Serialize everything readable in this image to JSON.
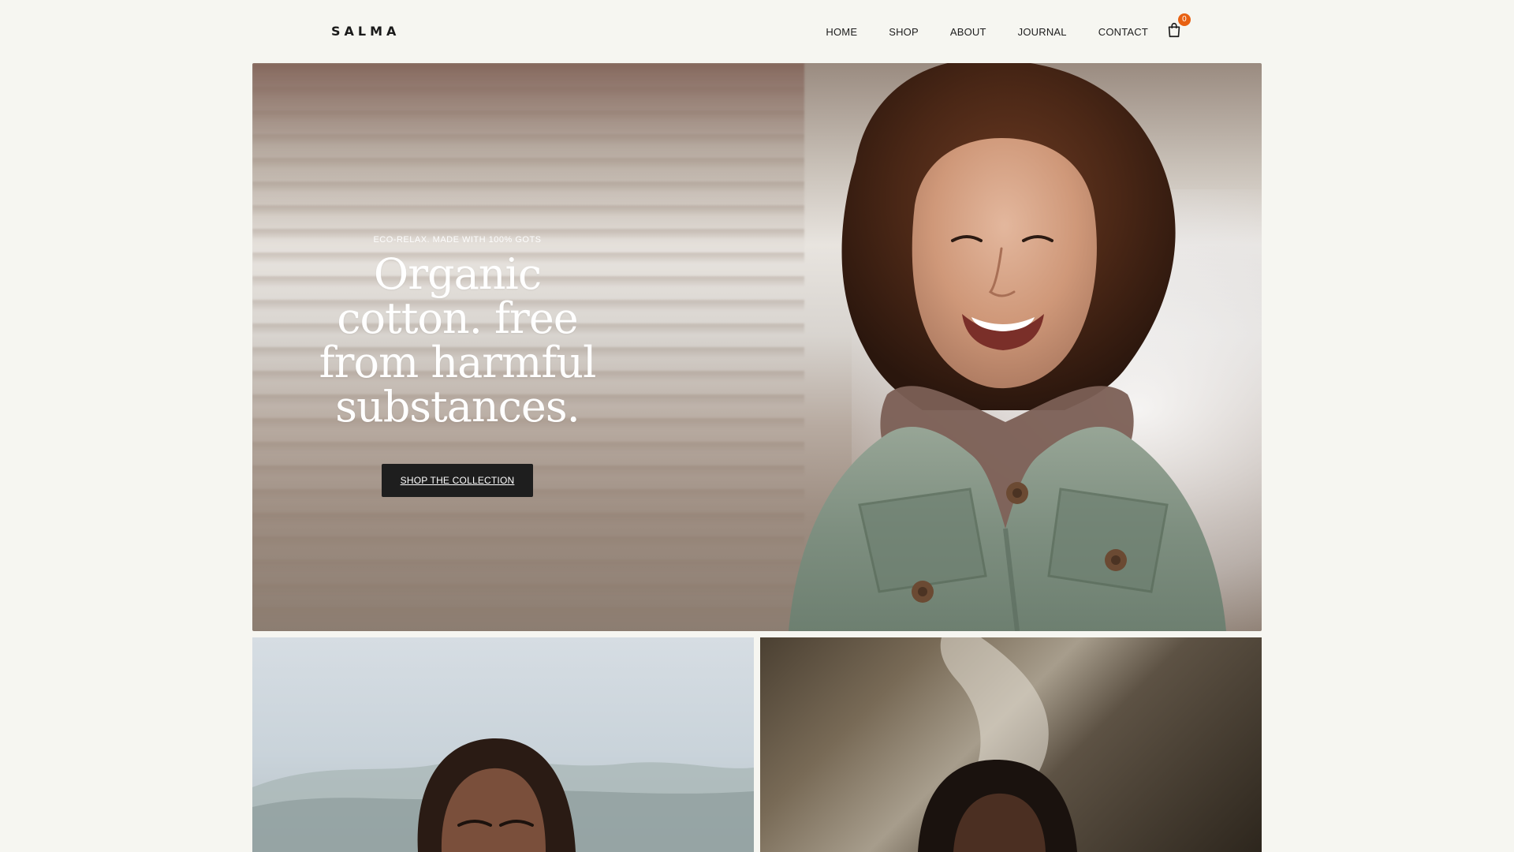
{
  "brand": {
    "name": "SALMA"
  },
  "nav": {
    "items": [
      {
        "label": "HOME"
      },
      {
        "label": "SHOP"
      },
      {
        "label": "ABOUT"
      },
      {
        "label": "JOURNAL"
      },
      {
        "label": "CONTACT"
      }
    ],
    "cart": {
      "icon": "shopping-bag-icon",
      "count": "0"
    }
  },
  "hero": {
    "eyebrow": "ECO-RELAX. MADE WITH 100% GOTS",
    "title_line1": "Organic cotton. free",
    "title_line2": "from harmful",
    "title_line3": "substances.",
    "cta_label": "SHOP THE COLLECTION"
  },
  "colors": {
    "background": "#f6f6f1",
    "accent": "#e86112",
    "button": "#1e1e1e"
  }
}
